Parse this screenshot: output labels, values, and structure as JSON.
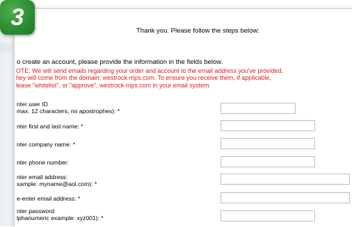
{
  "step_badge": {
    "number": "3",
    "color": "#2d8f35"
  },
  "header": {
    "thanks_text": "Thank you. Please follow the steps below:"
  },
  "intro_text": "o create an account, please provide the information in the fields below.",
  "note_lines": [
    "OTE: We will send emails regarding your order and account to the email address you've provided.",
    "hey will come from the domain: westrock-mps.com. To ensure you receive them, if applicable,",
    "lease \"whitelist\", or \"approve\", westrock-mps.com in your email system."
  ],
  "note_color": "#e01a1a",
  "form": {
    "user_id_label_1": "nter user ID",
    "user_id_label_2": "max. 12 characters, no apostrophes): *",
    "name_label": "nter first and last name: *",
    "company_label": "nter company name: *",
    "phone_label": "nter phone number:",
    "email_label_1": "nter email address:",
    "email_label_2": "xample: myname@aol.com): *",
    "reemail_label": "e-enter email address: *",
    "password_label_1": "nter password",
    "password_label_2": "lphanumeric example: xyz001): *"
  }
}
